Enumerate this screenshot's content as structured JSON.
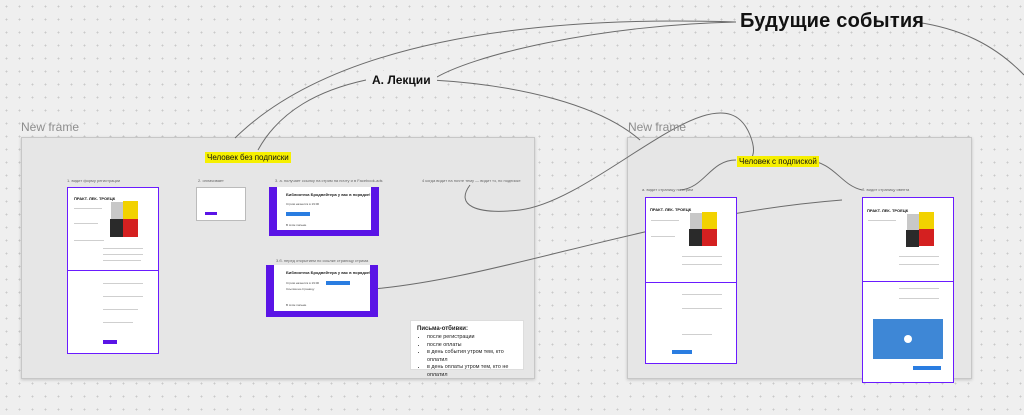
{
  "board": {
    "title": "Будущие события",
    "topic": "А. Лекции"
  },
  "frames": [
    {
      "label": "New frame",
      "highlight": "Человек без подписки",
      "steps": [
        "1. видит форму регистрации",
        "2. оплачивает",
        "3. а. получает ссылку на стрим на почту и в Facebook-ads",
        "4 когда видит на почте тему — видит тз, по подписке",
        "3.б. перед открытием по ссылке страницу стрима"
      ],
      "mail_title": "Библиотека Бродвейтера у вас в порядке!",
      "note": {
        "title": "Письма-отбивки:",
        "items": [
          "после регистрации",
          "после оплаты",
          "в день события утром тем, кто оплатил",
          "в день оплаты утром тем, кто не оплатил"
        ]
      }
    },
    {
      "label": "New frame",
      "highlight": "Человек с подпиской",
      "steps": [
        "а. видит страницу по стрим",
        "б. видит страницу ивента"
      ]
    }
  ]
}
